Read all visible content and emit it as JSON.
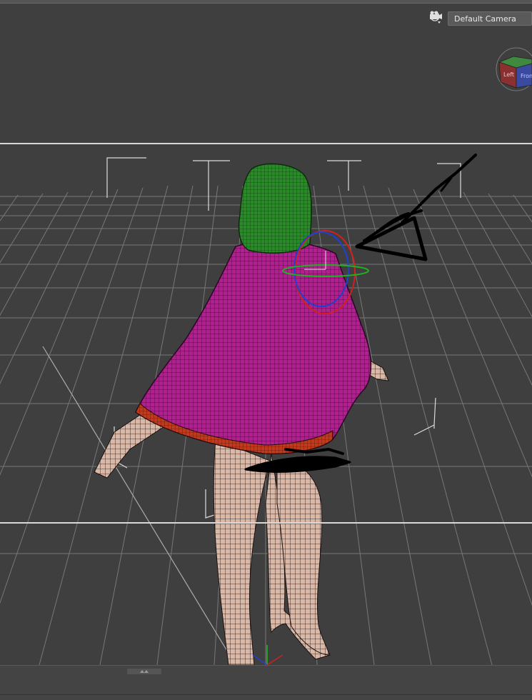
{
  "viewport": {
    "camera_label": "Default Camera",
    "viewcube_faces": {
      "left": "Left",
      "front": "Front"
    },
    "colors": {
      "background": "#3f3f3f",
      "grid": "#8a8a8a",
      "hood": "#2a8a2a",
      "cape": "#b0208f",
      "cape_trim": "#c23a1e",
      "skin_wire": "#d9b8a8",
      "rotate_x": "#d02020",
      "rotate_y": "#20b020",
      "rotate_z": "#2040d0"
    },
    "icons": {
      "nav": "view-orbit-icon",
      "camera": "camera-icon",
      "collapse": "collapse-arrows-icon"
    }
  }
}
